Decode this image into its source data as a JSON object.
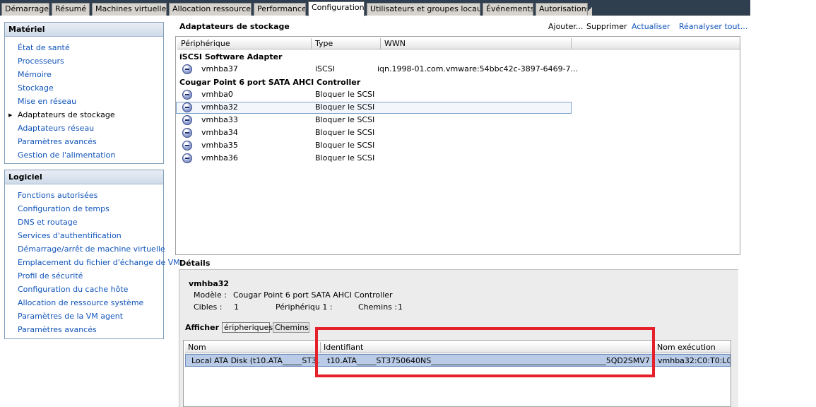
{
  "tabs": [
    {
      "label": "Démarrage"
    },
    {
      "label": "Résumé"
    },
    {
      "label": "Machines virtuelles"
    },
    {
      "label": "Allocation ressources"
    },
    {
      "label": "Performance"
    },
    {
      "label": "Configuration",
      "active": true
    },
    {
      "label": "Utilisateurs et groupes locaux"
    },
    {
      "label": "Événements"
    },
    {
      "label": "Autorisations"
    }
  ],
  "sidebar": {
    "hardware": {
      "title": "Matériel",
      "items": [
        "État de santé",
        "Processeurs",
        "Mémoire",
        "Stockage",
        "Mise en réseau",
        "Adaptateurs de stockage",
        "Adaptateurs réseau",
        "Paramètres avancés",
        "Gestion de l'alimentation"
      ]
    },
    "software": {
      "title": "Logiciel",
      "items": [
        "Fonctions autorisées",
        "Configuration de temps",
        "DNS et routage",
        "Services d'authentification",
        "Démarrage/arrêt de machine virtuelle",
        "Emplacement du fichier d'échange de VM",
        "Profil de sécurité",
        "Configuration du cache hôte",
        "Allocation de ressource système",
        "Paramètres de la VM agent",
        "Paramètres avancés"
      ]
    }
  },
  "main": {
    "title": "Adaptateurs de stockage",
    "actions": {
      "add": "Ajouter...",
      "remove": "Supprimer",
      "refresh": "Actualiser",
      "rescan": "Réanalyser tout..."
    },
    "columns": {
      "device": "Périphérique",
      "type": "Type",
      "wwn": "WWN"
    },
    "groups": [
      {
        "name": "iSCSI Software Adapter",
        "rows": [
          {
            "device": "vmhba37",
            "type": "iSCSI",
            "wwn": "iqn.1998-01.com.vmware:54bbc42c-3897-6469-7..."
          }
        ]
      },
      {
        "name": "Cougar Point 6 port SATA AHCI Controller",
        "rows": [
          {
            "device": "vmhba0",
            "type": "Bloquer le SCSI",
            "wwn": ""
          },
          {
            "device": "vmhba32",
            "type": "Bloquer le SCSI",
            "wwn": "",
            "selected": true
          },
          {
            "device": "vmhba33",
            "type": "Bloquer le SCSI",
            "wwn": ""
          },
          {
            "device": "vmhba34",
            "type": "Bloquer le SCSI",
            "wwn": ""
          },
          {
            "device": "vmhba35",
            "type": "Bloquer le SCSI",
            "wwn": ""
          },
          {
            "device": "vmhba36",
            "type": "Bloquer le SCSI",
            "wwn": ""
          }
        ]
      }
    ]
  },
  "details": {
    "title": "Détails",
    "adapter": "vmhba32",
    "model_label": "Modèle :",
    "model_value": "Cougar Point 6 port SATA AHCI Controller",
    "targets_label": "Cibles :",
    "targets_value": "1",
    "devices_label": "Périphériqu 1 :",
    "paths_label": "Chemins :",
    "paths_value": "1",
    "show_label": "Afficher :",
    "show_devices": "éripheriques",
    "show_paths": "Chemins",
    "columns": {
      "name": "Nom",
      "identifier": "Identifiant",
      "runtime": "Nom exécution"
    },
    "row": {
      "name": "Local ATA Disk (t10.ATA_____ST3...",
      "identifier": "t10.ATA_____ST3750640NS_____________________________________________5QD2SMV7",
      "runtime": "vmhba32:C0:T0:L0"
    }
  },
  "colors": {
    "tabbar": "#2f3f4f",
    "link": "#1155bb",
    "selection": "#b9cbe6",
    "highlight": "#e5202a"
  }
}
